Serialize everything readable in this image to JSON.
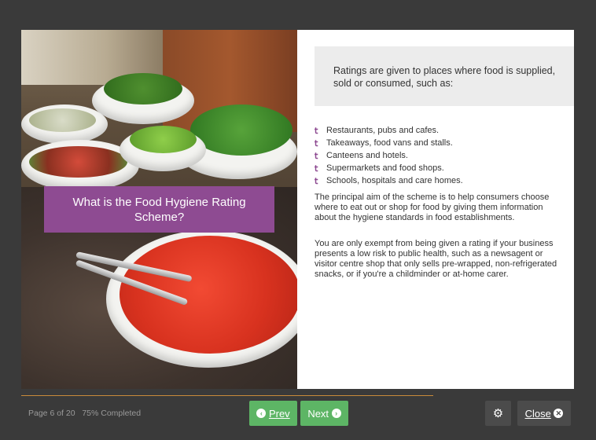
{
  "slide": {
    "title": "What is the Food Hygiene Rating Scheme?",
    "intro": "Ratings are given to places where food is supplied, sold or consumed, such as:",
    "bullets": [
      "Restaurants, pubs and cafes.",
      "Takeaways, food vans and stalls.",
      "Canteens and hotels.",
      "Supermarkets and food shops.",
      "Schools, hospitals and care homes."
    ],
    "paragraph1": "The principal aim of the scheme is to help consumers choose where to eat out or shop for food by giving them information about the hygiene standards in food establishments.",
    "paragraph2": "You are only exempt from being given a rating if your business presents a low risk to public health, such as a newsagent or visitor centre shop that only sells pre-wrapped, non-refrigerated snacks, or if you're a childminder or at-home carer.",
    "bullet_icon": "fork-knife-icon",
    "accent_color": "#8e4b92"
  },
  "footer": {
    "page_status": "Page 6 of 20",
    "completed": "75% Completed",
    "progress_percent": 75,
    "prev_label": "Prev",
    "next_label": "Next",
    "close_label": "Close",
    "settings_icon": "settings-gears-icon",
    "button_color": "#5db565"
  }
}
